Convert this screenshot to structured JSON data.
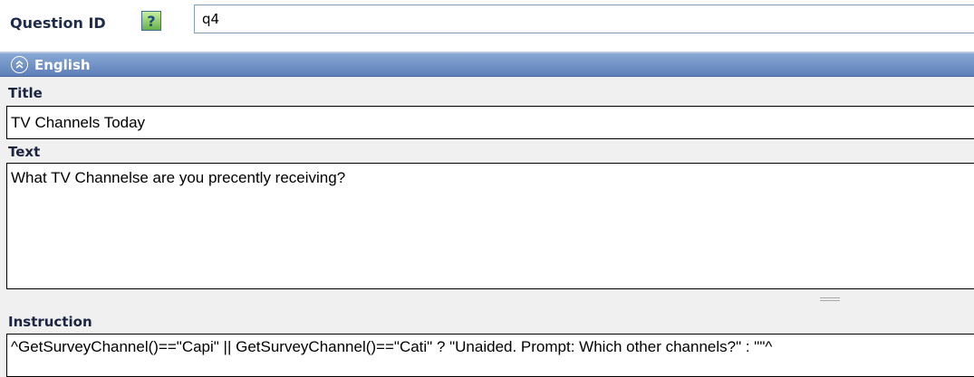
{
  "question_id": {
    "label": "Question ID",
    "help_icon": "help-question-icon",
    "value": "q4"
  },
  "language_section": {
    "title": "English",
    "collapse_icon": "collapse-up-icon",
    "fields": {
      "title_label": "Title",
      "title_value": "TV Channels Today",
      "text_label": "Text",
      "text_value": "What TV Channelse are you precently receiving?",
      "instruction_label": "Instruction",
      "instruction_value": "^GetSurveyChannel()==\"Capi\" || GetSurveyChannel()==\"Cati\" ? \"Unaided. Prompt: Which other channels?\" : \"\"^"
    }
  },
  "colors": {
    "header_gradient_top": "#88a8d4",
    "header_gradient_bottom": "#5d7fb8",
    "label_text": "#1b2440",
    "panel_background": "#f0f0f0"
  }
}
